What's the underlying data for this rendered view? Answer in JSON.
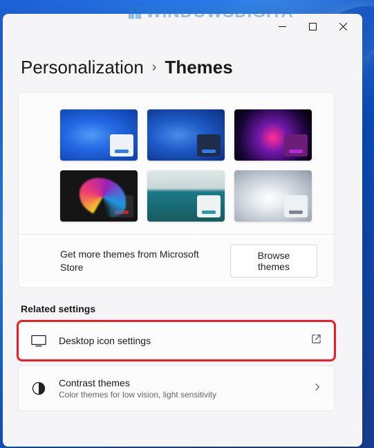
{
  "watermark": {
    "text": "WINDOWSDIGITA"
  },
  "breadcrumb": {
    "parent": "Personalization",
    "separator": "›",
    "current": "Themes"
  },
  "themes": [
    {
      "name": "windows-light",
      "overlay_bg": "#eef2f6",
      "accent": "#2f7de8"
    },
    {
      "name": "windows-dark",
      "overlay_bg": "#1f2d4a",
      "accent": "#2f7de8"
    },
    {
      "name": "glow",
      "overlay_bg": "#6b1d77",
      "accent": "#b02dd5"
    },
    {
      "name": "captured-motion",
      "overlay_bg": "#2b2b2b",
      "accent": "#c0242b"
    },
    {
      "name": "sunrise",
      "overlay_bg": "#eef2f2",
      "accent": "#2a9aa3"
    },
    {
      "name": "flow",
      "overlay_bg": "#eef1f4",
      "accent": "#7b8592"
    }
  ],
  "store": {
    "text": "Get more themes from Microsoft Store",
    "button": "Browse themes"
  },
  "related": {
    "heading": "Related settings",
    "rows": [
      {
        "icon": "monitor-icon",
        "title": "Desktop icon settings",
        "subtitle": "",
        "action": "external-link",
        "highlighted": true
      },
      {
        "icon": "contrast-icon",
        "title": "Contrast themes",
        "subtitle": "Color themes for low vision, light sensitivity",
        "action": "chevron",
        "highlighted": false
      }
    ]
  }
}
